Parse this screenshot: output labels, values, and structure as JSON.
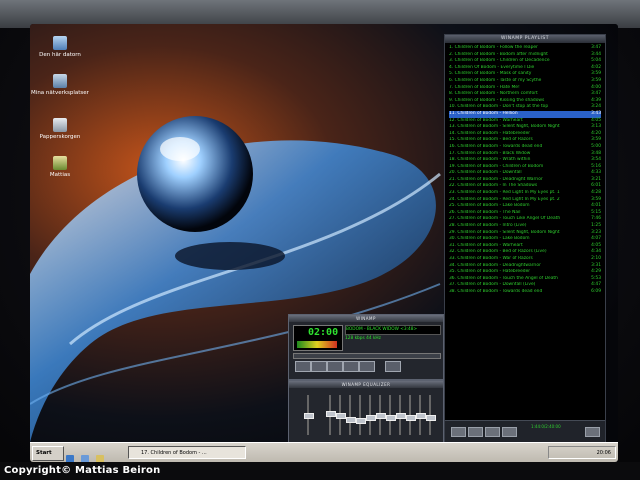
{
  "desktop": {
    "icons": [
      {
        "label": "Den här datorn"
      },
      {
        "label": "Mina nätverksplatser"
      },
      {
        "label": "Papperskorgen"
      },
      {
        "label": "Mattias"
      }
    ]
  },
  "playlist": {
    "title": "WINAMP PLAYLIST",
    "selected_index": 10,
    "items": [
      {
        "title": "1. Children of Bodom - Follow the reaper",
        "time": "3:47"
      },
      {
        "title": "2. Children of Bodom - Bodom after midnight",
        "time": "3:44"
      },
      {
        "title": "3. Children of Bodom - Children of Decadence",
        "time": "5:04"
      },
      {
        "title": "4. Children Of Bodom - Everytime I Die",
        "time": "4:02"
      },
      {
        "title": "5. Children of Bodom - Mask of sanity",
        "time": "3:59"
      },
      {
        "title": "6. Children of Bodom - Taste of my Scythe",
        "time": "3:59"
      },
      {
        "title": "7. Children of Bodom - Hate Me!",
        "time": "4:00"
      },
      {
        "title": "8. Children of Bodom - Northern comfort",
        "time": "3:47"
      },
      {
        "title": "9. Children of Bodom - Kissing the shadows",
        "time": "4:39"
      },
      {
        "title": "10. Children of Bodom - Don't stop at the top",
        "time": "3:24"
      },
      {
        "title": "11. Children of Bodom - Hellion",
        "time": "3:43"
      },
      {
        "title": "12. Children of Bodom - Warheart",
        "time": "4:05"
      },
      {
        "title": "13. Children of Bodom - Silent Night, Bodom Night",
        "time": "3:13"
      },
      {
        "title": "14. Children of Bodom - Hatebreeder",
        "time": "4:20"
      },
      {
        "title": "15. Children of Bodom - Bed of Razors",
        "time": "3:59"
      },
      {
        "title": "16. Children of Bodom - Towards dead end",
        "time": "5:00"
      },
      {
        "title": "17. Children of Bodom - Black Widow",
        "time": "3:48"
      },
      {
        "title": "18. Children of Bodom - Wrath within",
        "time": "3:54"
      },
      {
        "title": "19. Children of Bodom - Children of Bodom",
        "time": "5:16"
      },
      {
        "title": "20. Children of Bodom - Downfall",
        "time": "4:33"
      },
      {
        "title": "21. Children of Bodom - Deadnight Warrior",
        "time": "3:21"
      },
      {
        "title": "22. Children of Bodom - In The Shadows",
        "time": "6:01"
      },
      {
        "title": "23. Children of Bodom - Red Light In My Eyes pt. 1",
        "time": "4:28"
      },
      {
        "title": "24. Children of Bodom - Red Light In My Eyes pt. 2",
        "time": "3:59"
      },
      {
        "title": "25. Children of Bodom - Lake Bodom",
        "time": "4:01"
      },
      {
        "title": "26. Children of Bodom - The Nail",
        "time": "5:15"
      },
      {
        "title": "27. Children of Bodom - Touch Like Angel Of Death",
        "time": "7:46"
      },
      {
        "title": "28. Children of Bodom - Intro (Live)",
        "time": "1:25"
      },
      {
        "title": "29. Children of Bodom - Silent Night, Bodom Night",
        "time": "3:23"
      },
      {
        "title": "30. Children of Bodom - Lake Bodom",
        "time": "4:07"
      },
      {
        "title": "31. Children of Bodom - Warheart",
        "time": "4:05"
      },
      {
        "title": "32. Children of Bodom - Bed of Razors (Live)",
        "time": "4:34"
      },
      {
        "title": "33. Children of Bodom - War of Razors",
        "time": "2:10"
      },
      {
        "title": "34. Children of Bodom - Deadnightwarrior",
        "time": "3:31"
      },
      {
        "title": "35. Children of Bodom - Hatebreeder",
        "time": "4:29"
      },
      {
        "title": "36. Children of Bodom - Touch the Angel of Death",
        "time": "5:53"
      },
      {
        "title": "37. Children of Bodom - Downfall (Live)",
        "time": "4:47"
      },
      {
        "title": "38. Children of Bodom - Towards dead end",
        "time": "6:09"
      }
    ],
    "time_display": "1:44:0/2:40:00"
  },
  "player": {
    "title": "WINAMP",
    "clock": "02:00",
    "marquee": "BODOM - BLACK WIDOW <3:48>",
    "kbps": "128 kbps  44 kHz"
  },
  "equalizer": {
    "title": "WINAMP EQUALIZER",
    "levels": [
      0.55,
      0.5,
      0.4,
      0.35,
      0.45,
      0.5,
      0.45,
      0.5,
      0.45,
      0.5,
      0.45
    ]
  },
  "taskbar": {
    "start_label": "Start",
    "task_label": "17. Children of Bodom - ...",
    "clock": "20:06"
  },
  "copyright": "Copyright© Mattias Beiron",
  "colors": {
    "playlist_text": "#2fd02f",
    "playlist_selected": "#2a61c8",
    "lcd_green": "#2fe02f"
  }
}
